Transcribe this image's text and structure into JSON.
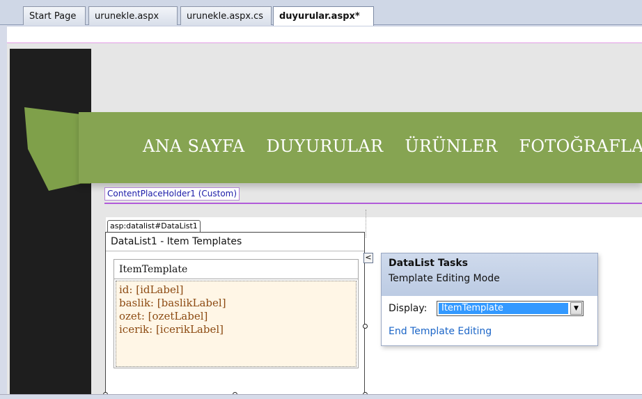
{
  "tabs": [
    {
      "label": "Start Page",
      "active": false
    },
    {
      "label": "urunekle.aspx",
      "active": false
    },
    {
      "label": "urunekle.aspx.cs",
      "active": false
    },
    {
      "label": "duyurular.aspx*",
      "active": true
    }
  ],
  "site": {
    "menu": [
      "ANA SAYFA",
      "DUYURULAR",
      "ÜRÜNLER",
      "FOTOĞRAFLAR"
    ],
    "ribbon_color": "#86a452",
    "sidebar_color": "#1e1e1e"
  },
  "content_placeholder_label": "ContentPlaceHolder1 (Custom)",
  "datalist": {
    "tag_label": "asp:datalist#DataList1",
    "title": "DataList1 - Item Templates",
    "template_header": "ItemTemplate",
    "template_lines": [
      "id: [idLabel]",
      "baslik: [baslikLabel]",
      "ozet: [ozetLabel]",
      "icerik: [icerikLabel]"
    ]
  },
  "tasks_panel": {
    "chevron_glyph": "<",
    "title": "DataList Tasks",
    "subtitle": "Template Editing Mode",
    "display_label": "Display:",
    "display_value": "ItemTemplate",
    "dropdown_glyph": "▼",
    "end_link": "End Template Editing"
  }
}
